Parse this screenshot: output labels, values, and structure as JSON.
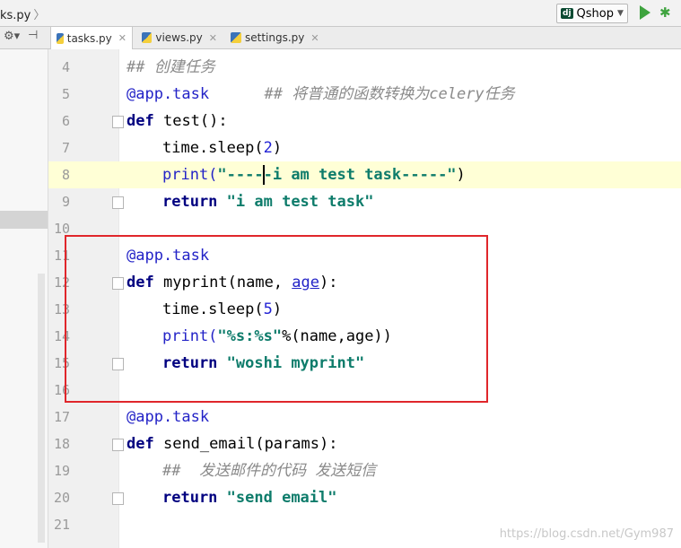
{
  "topbar": {
    "breadcrumb": "ks.py",
    "run_config": "Qshop"
  },
  "tabs": [
    {
      "label": "tasks.py",
      "active": true
    },
    {
      "label": "views.py",
      "active": false
    },
    {
      "label": "settings.py",
      "active": false
    }
  ],
  "code": {
    "lines": [
      {
        "n": "4",
        "text": "## 创建任务"
      },
      {
        "n": "5",
        "decorator": "@app.task",
        "comment": "## 将普通的函数转换为celery任务"
      },
      {
        "n": "6",
        "def": "def",
        "name": "test",
        "rest": "():"
      },
      {
        "n": "7",
        "pre": "time.sleep(",
        "num": "2",
        "post": ")"
      },
      {
        "n": "8",
        "pre": "print(",
        "str_a": "\"----",
        "str_b": "-i am test task-----\"",
        "post": ")"
      },
      {
        "n": "9",
        "kw": "return",
        "str": "\"i am test task\""
      },
      {
        "n": "10"
      },
      {
        "n": "11",
        "decorator": "@app.task"
      },
      {
        "n": "12",
        "def": "def",
        "name": "myprint",
        "args": "(name, ",
        "param": "age",
        "rest": "):"
      },
      {
        "n": "13",
        "pre": "time.sleep(",
        "num": "5",
        "post": ")"
      },
      {
        "n": "14",
        "pre": "print(",
        "str": "\"%s:%s\"",
        "post": "%(name,age))"
      },
      {
        "n": "15",
        "kw": "return",
        "str": "\"woshi myprint\""
      },
      {
        "n": "16"
      },
      {
        "n": "17",
        "decorator": "@app.task"
      },
      {
        "n": "18",
        "def": "def",
        "name": "send_email",
        "rest": "(params):"
      },
      {
        "n": "19",
        "text": "##  发送邮件的代码 发送短信"
      },
      {
        "n": "20",
        "kw": "return",
        "str": "\"send email\""
      },
      {
        "n": "21"
      }
    ]
  },
  "watermark": "https://blog.csdn.net/Gym987",
  "colors": {
    "keyword": "#000080",
    "string": "#0e7c6b",
    "decorator": "#2323c7",
    "comment": "#8a8a8a",
    "highlight_box": "#e0262b",
    "current_line": "#ffffd6"
  }
}
